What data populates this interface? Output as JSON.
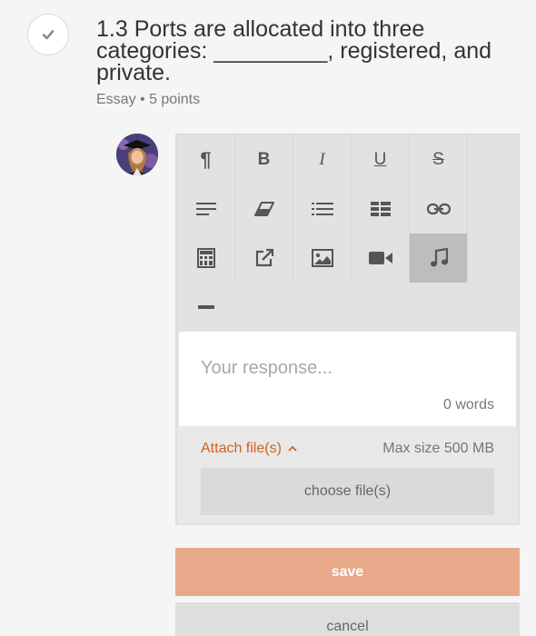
{
  "question": {
    "text": "1.3 Ports are allocated into three categories: _________, registered, and private.",
    "meta": "Essay • 5 points",
    "status_icon": "check-icon"
  },
  "toolbar": {
    "buttons": [
      {
        "name": "paragraph",
        "glyph": "¶"
      },
      {
        "name": "bold",
        "glyph": "B"
      },
      {
        "name": "italic",
        "glyph": "I"
      },
      {
        "name": "underline",
        "glyph": "U"
      },
      {
        "name": "strikethrough",
        "glyph": "S"
      },
      {
        "name": "align",
        "glyph": ""
      },
      {
        "name": "eraser",
        "glyph": ""
      },
      {
        "name": "list",
        "glyph": ""
      },
      {
        "name": "table",
        "glyph": ""
      },
      {
        "name": "link",
        "glyph": ""
      },
      {
        "name": "calculator",
        "glyph": ""
      },
      {
        "name": "external-link",
        "glyph": ""
      },
      {
        "name": "image",
        "glyph": ""
      },
      {
        "name": "video",
        "glyph": ""
      },
      {
        "name": "music",
        "glyph": ""
      },
      {
        "name": "horizontal-rule",
        "glyph": ""
      }
    ]
  },
  "response": {
    "placeholder": "Your response...",
    "word_count": "0 words"
  },
  "attach": {
    "label": "Attach file(s)",
    "caret": "^",
    "max_size": "Max size 500 MB",
    "choose_label": "choose file(s)"
  },
  "actions": {
    "save_label": "save",
    "cancel_label": "cancel"
  }
}
